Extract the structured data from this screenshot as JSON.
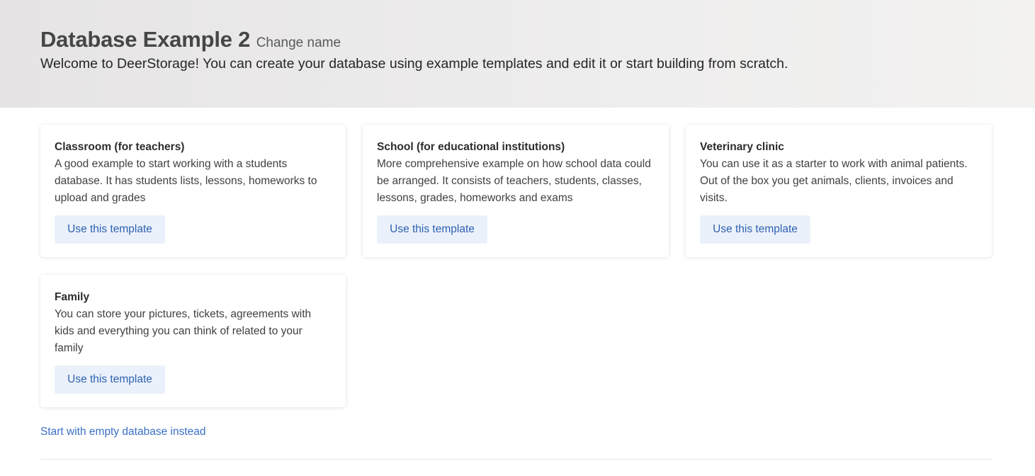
{
  "header": {
    "database_name": "Database Example 2",
    "change_name_label": "Change name",
    "welcome_text": "Welcome to DeerStorage! You can create your database using example templates and edit it or start building from scratch."
  },
  "templates": [
    {
      "title": "Classroom (for teachers)",
      "description": "A good example to start working with a students database. It has students lists, lessons, homeworks to upload and grades",
      "button_label": "Use this template"
    },
    {
      "title": "School (for educational institutions)",
      "description": "More comprehensive example on how school data could be arranged. It consists of teachers, students, classes, lessons, grades, homeworks and exams",
      "button_label": "Use this template"
    },
    {
      "title": "Veterinary clinic",
      "description": "You can use it as a starter to work with animal patients. Out of the box you get animals, clients, invoices and visits.",
      "button_label": "Use this template"
    },
    {
      "title": "Family",
      "description": "You can store your pictures, tickets, agreements with kids and everything you can think of related to your family",
      "button_label": "Use this template"
    }
  ],
  "footer": {
    "empty_database_link": "Start with empty database instead"
  },
  "colors": {
    "accent": "#2d61b2",
    "button_bg": "#ebf1fa",
    "hero_bg": "#ebeae9"
  }
}
